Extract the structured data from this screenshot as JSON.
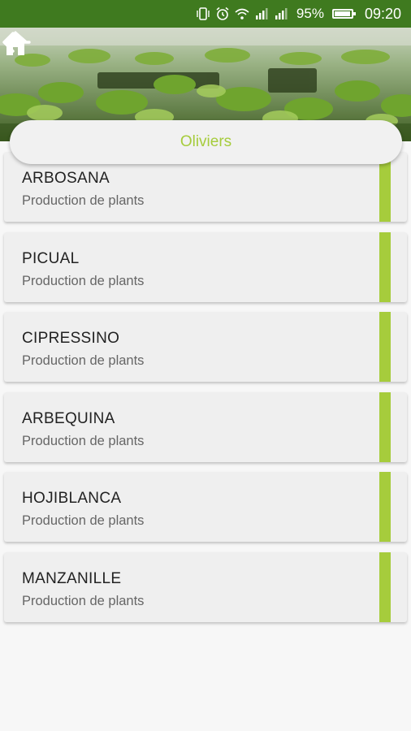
{
  "status_bar": {
    "battery_percent": "95%",
    "battery_level": 0.95,
    "time": "09:20",
    "icons": [
      "vibrate-icon",
      "alarm-icon",
      "wifi-icon",
      "signal-icon",
      "signal-icon",
      "battery-icon"
    ]
  },
  "header": {
    "back_icon": "arrow-left-icon",
    "home_icon": "home-icon"
  },
  "title": "Oliviers",
  "colors": {
    "accent": "#a6cc3c",
    "status_bar": "#3f7a1f",
    "card_bg": "#efefef"
  },
  "varieties": [
    {
      "name": "ARBOSANA",
      "subtitle": "Production de plants"
    },
    {
      "name": "PICUAL",
      "subtitle": "Production de plants"
    },
    {
      "name": "CIPRESSINO",
      "subtitle": "Production de plants"
    },
    {
      "name": "ARBEQUINA",
      "subtitle": "Production de plants"
    },
    {
      "name": "HOJIBLANCA",
      "subtitle": "Production de plants"
    },
    {
      "name": "MANZANILLE",
      "subtitle": "Production de plants"
    }
  ]
}
